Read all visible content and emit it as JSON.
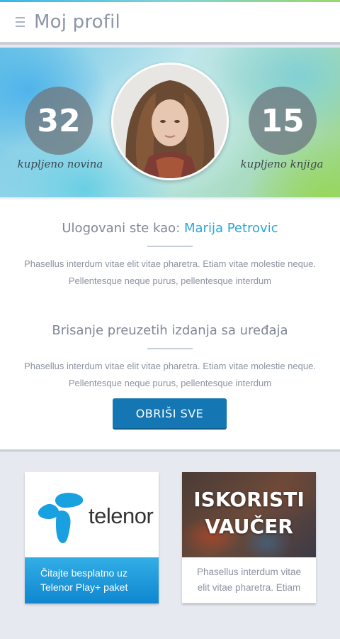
{
  "header": {
    "title": "Moj profil",
    "menu_icon": "hamburger-menu-icon"
  },
  "profile": {
    "newspapers_count": "32",
    "newspapers_label": "kupljeno novina",
    "books_count": "15",
    "books_label": "kupljeno knjiga"
  },
  "login": {
    "label": "Ulogovani ste kao: ",
    "user_name": "Marija Petrovic",
    "description": "Phasellus interdum vitae elit vitae pharetra. Etiam vitae molestie neque. Pellentesque neque purus, pellentesque interdum"
  },
  "delete_section": {
    "title": "Brisanje preuzetih izdanja sa uređaja",
    "description": "Phasellus interdum vitae elit vitae pharetra. Etiam vitae molestie neque. Pellentesque neque purus, pellentesque interdum",
    "button_label": "OBRIŠI SVE"
  },
  "promo_cards": [
    {
      "brand": "telenor",
      "text_line1": "Čitajte besplatno uz",
      "text_line2": "Telenor Play+ paket"
    },
    {
      "title_line1": "ISKORISTI",
      "title_line2": "VAUČER",
      "text_line1": "Phasellus interdum vitae",
      "text_line2": "elit vitae pharetra. Etiam"
    }
  ],
  "colors": {
    "accent_blue": "#2aa6da",
    "button_blue": "#1477b3",
    "telenor_blue": "#1a9ad9"
  }
}
